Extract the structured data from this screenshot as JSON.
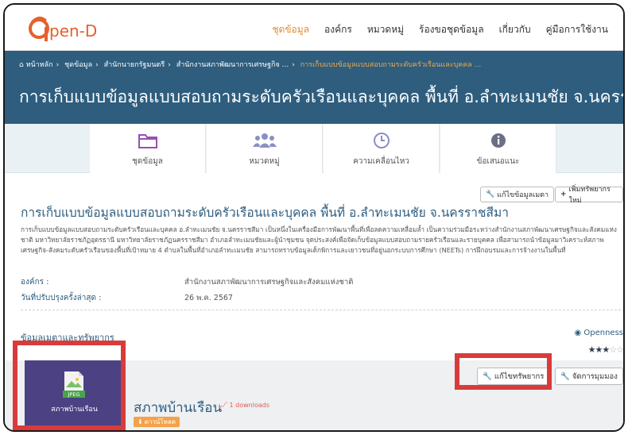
{
  "brand": {
    "logo_text": "pen-D",
    "accent": "#e58a2c",
    "primary": "#2e5d7e"
  },
  "nav": {
    "items": [
      {
        "label": "ชุดข้อมูล",
        "active": true
      },
      {
        "label": "องค์กร"
      },
      {
        "label": "หมวดหมู่"
      },
      {
        "label": "ร้องขอชุดข้อมูล"
      },
      {
        "label": "เกี่ยวกับ"
      },
      {
        "label": "คู่มือการใช้งาน"
      }
    ]
  },
  "breadcrumb": {
    "home": "หน้าหลัก",
    "items": [
      "ชุดข้อมูล",
      "สำนักนายกรัฐมนตรี",
      "สำนักงานสภาพัฒนาการเศรษฐกิจ ..."
    ],
    "current": "การเก็บแบบข้อมูลแบบสอบถามระดับครัวเรือนและบุคคล ..."
  },
  "hero": {
    "title": "การเก็บแบบข้อมูลแบบสอบถามระดับครัวเรือนและบุคคล พื้นที่ อ.ลำทะเมนชัย จ.นครราชสีมา"
  },
  "tabs": [
    {
      "label": "ชุดข้อมูล",
      "icon": "folder-icon"
    },
    {
      "label": "หมวดหมู่",
      "icon": "users-icon"
    },
    {
      "label": "ความเคลื่อนไหว",
      "icon": "clock-icon"
    },
    {
      "label": "ข้อเสนอแนะ",
      "icon": "info-icon"
    }
  ],
  "actions": {
    "edit_metadata": "แก้ไขข้อมูลเมตา",
    "add_resource": "เพิ่มทรัพยากรใหม่"
  },
  "dataset": {
    "title": "การเก็บแบบข้อมูลแบบสอบถามระดับครัวเรือนและบุคคล พื้นที่ อ.ลำทะเมนชัย จ.นครราชสีมา",
    "description": "การเก็บแบบข้อมูลแบบสอบถามระดับครัวเรือนและบุคคล อ.ลำทะเมนชัย จ.นครราชสีมา เป็นหนึ่งในเครื่องมือการพัฒนาพื้นที่เพื่อลดความเหลื่อมล้ำ เป็นความร่วมมือระหว่างสำนักงานสภาพัฒนาเศรษฐกิจและสังคมแห่งชาติ มหาวิทยาลัยราชภัฏอุดรธานี มหาวิทยาลัยราชภัฏนครราชสีมา อำเภอลำทะเมนชัยและผู้นำชุมชน จุดประสงค์เพื่อจัดเก็บข้อมูลแบบสอบถามรายครัวเรือนและรายบุคคล เพื่อสามารถนำข้อมูลมาวิเคราะห์สภาพเศรษฐกิจ-สังคมระดับครัวเรือนของพื้นที่เป้าหมาย 4 ตำบลในพื้นที่อำเภอลำทะเมนชัย สามารถทราบข้อมูลเด็กพิการและเยาวชนที่อยู่นอกระบบการศึกษา (NEETs) การฝึกอบรมและการจ้างงานในพื้นที่",
    "org_label": "องค์กร :",
    "org_value": "สำนักงานสภาพัฒนาการเศรษฐกิจและสังคมแห่งชาติ",
    "updated_label": "วันที่ปรับปรุงครั้งล่าสุด :",
    "updated_value": "26 พ.ค. 2567"
  },
  "resources_section": {
    "label": "ข้อมูลเมตาและทรัพยากร",
    "openness_label": "Openness",
    "openness_stars": 3,
    "openness_max": 5
  },
  "resource": {
    "thumb_format": "JPEG",
    "thumb_label": "สภาพบ้านเรือน",
    "title": "สภาพบ้านเรือน",
    "downloads": "1 downloads",
    "download_button": "ดาวน์โหลด",
    "edit_button": "แก้ไขทรัพยากร",
    "manage_button": "จัดการมุมมอง"
  },
  "highlight_color": "#d93b3b"
}
